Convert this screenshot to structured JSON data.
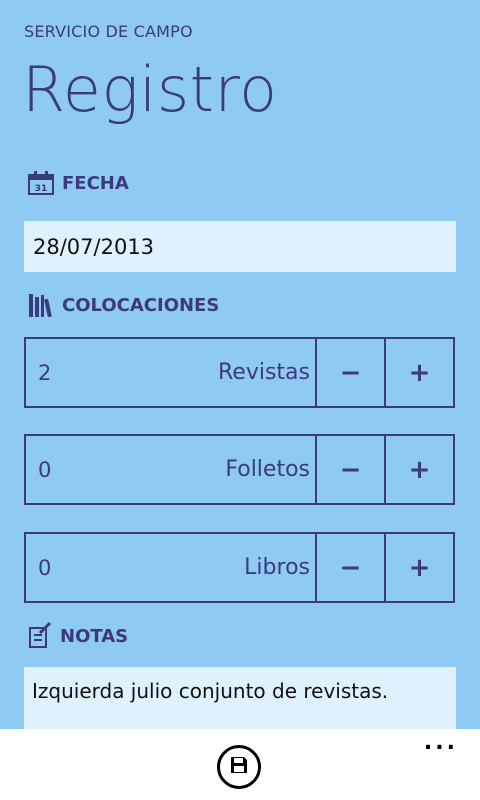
{
  "app_label": "SERVICIO DE CAMPO",
  "page_title": "Registro",
  "sections": {
    "fecha": {
      "label": "FECHA",
      "icon": "calendar-icon",
      "value": "28/07/2013"
    },
    "colocaciones": {
      "label": "COLOCACIONES",
      "icon": "books-icon"
    },
    "notas": {
      "label": "NOTAS",
      "icon": "notes-icon",
      "value": "Izquierda julio conjunto de revistas."
    }
  },
  "counters": [
    {
      "label": "Revistas",
      "value": "2",
      "minus": "−",
      "plus": "+"
    },
    {
      "label": "Folletos",
      "value": "0",
      "minus": "−",
      "plus": "+"
    },
    {
      "label": "Libros",
      "value": "0",
      "minus": "−",
      "plus": "+"
    }
  ],
  "app_bar": {
    "save_icon": "save-icon",
    "more_label": "..."
  },
  "colors": {
    "background": "#8ecaf4",
    "accent": "#3d3a7c",
    "field": "#dff1fd",
    "app_bar": "#ffffff"
  }
}
